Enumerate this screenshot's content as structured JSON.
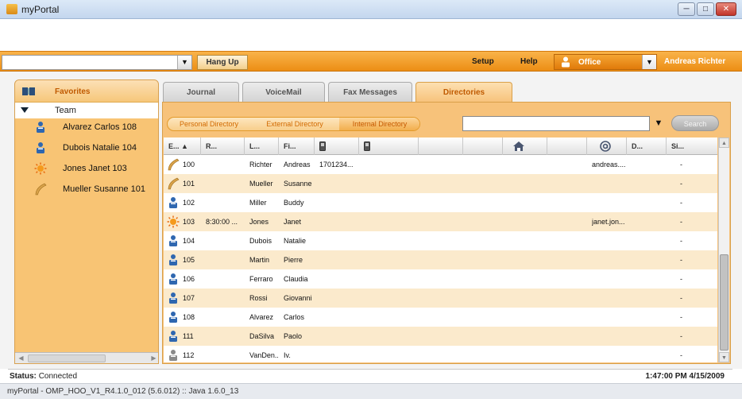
{
  "window": {
    "title": "myPortal",
    "buttons": [
      "─",
      "□",
      "✕"
    ]
  },
  "toolbar": {
    "hangup_label": "Hang Up",
    "setup_label": "Setup",
    "help_label": "Help",
    "status_value": "Office",
    "user_name": "Andreas Richter",
    "dropdown_glyph": "▼"
  },
  "sidebar": {
    "header": "Favorites",
    "group": "Team",
    "items": [
      {
        "label": "Alvarez Carlos  108",
        "icon": "person-icon"
      },
      {
        "label": "Dubois Natalie  104",
        "icon": "person-icon"
      },
      {
        "label": "Jones Janet  103",
        "icon": "sun-icon"
      },
      {
        "label": "Mueller Susanne  101",
        "icon": "phone-icon"
      }
    ]
  },
  "tabs": [
    "Journal",
    "VoiceMail",
    "Fax Messages",
    "Directories"
  ],
  "subtabs": [
    "Personal Directory",
    "External Directory",
    "Internal Directory"
  ],
  "search": {
    "button": "Search",
    "value": "",
    "dropdown_glyph": "▼"
  },
  "table": {
    "headers": [
      "E...  ▲",
      "R...",
      "L...",
      "Fi...",
      "",
      "",
      "",
      "",
      "",
      "",
      "",
      "",
      "D...",
      "Si..."
    ],
    "header_icons": {
      "4": "mobile-icon",
      "5": "mobile-icon",
      "8": "home-icon",
      "10": "at-icon"
    },
    "rows": [
      {
        "icon": "phone-icon",
        "ext": "100",
        "time": "",
        "last": "Richter",
        "first": "Andreas",
        "phone": "1701234...",
        "email": "andreas....",
        "si": "-"
      },
      {
        "icon": "phone-icon",
        "ext": "101",
        "time": "",
        "last": "Mueller",
        "first": "Susanne",
        "phone": "",
        "email": "",
        "si": "-"
      },
      {
        "icon": "person-icon",
        "ext": "102",
        "time": "",
        "last": "Miller",
        "first": "Buddy",
        "phone": "",
        "email": "",
        "si": "-"
      },
      {
        "icon": "sun-icon",
        "ext": "103",
        "time": "8:30:00 ...",
        "last": "Jones",
        "first": "Janet",
        "phone": "",
        "email": "janet.jon...",
        "si": "-"
      },
      {
        "icon": "person-icon",
        "ext": "104",
        "time": "",
        "last": "Dubois",
        "first": "Natalie",
        "phone": "",
        "email": "",
        "si": "-"
      },
      {
        "icon": "person-icon",
        "ext": "105",
        "time": "",
        "last": "Martin",
        "first": "Pierre",
        "phone": "",
        "email": "",
        "si": "-"
      },
      {
        "icon": "person-icon",
        "ext": "106",
        "time": "",
        "last": "Ferraro",
        "first": "Claudia",
        "phone": "",
        "email": "",
        "si": "-"
      },
      {
        "icon": "person-icon",
        "ext": "107",
        "time": "",
        "last": "Rossi",
        "first": "Giovanni",
        "phone": "",
        "email": "",
        "si": "-"
      },
      {
        "icon": "person-icon",
        "ext": "108",
        "time": "",
        "last": "Alvarez",
        "first": "Carlos",
        "phone": "",
        "email": "",
        "si": "-"
      },
      {
        "icon": "person-icon",
        "ext": "111",
        "time": "",
        "last": "DaSilva",
        "first": "Paolo",
        "phone": "",
        "email": "",
        "si": "-"
      },
      {
        "icon": "person-gray-icon",
        "ext": "112",
        "time": "",
        "last": "VanDen...",
        "first": "Iv.",
        "phone": "",
        "email": "",
        "si": "-"
      }
    ]
  },
  "status": {
    "label": "Status:",
    "value": "Connected",
    "datetime": "1:47:00 PM 4/15/2009"
  },
  "footer": {
    "text": "myPortal - OMP_HOO_V1_R4.1.0_012 (5.6.012) :: Java 1.6.0_13"
  },
  "colors": {
    "accent": "#ef9a1f",
    "tab_active_text": "#c05a00",
    "row_alt": "#fbeacc"
  }
}
